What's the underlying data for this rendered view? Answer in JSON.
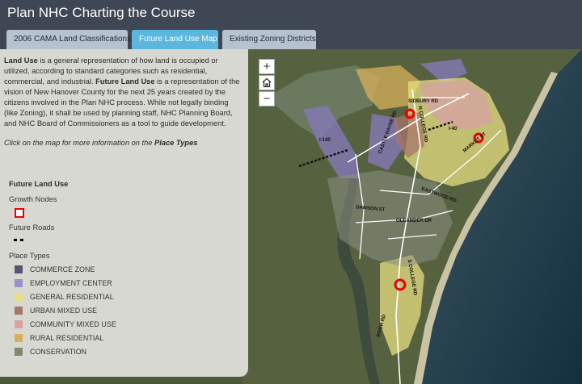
{
  "app": {
    "title": "Plan NHC Charting the Course"
  },
  "tabs": [
    {
      "label": "2006 CAMA Land Classifications",
      "active": false
    },
    {
      "label": "Future Land Use Map",
      "active": true
    },
    {
      "label": "Existing Zoning Districts",
      "active": false
    }
  ],
  "panel": {
    "intro_part1_bold": "Land Use",
    "intro_part1": " is a general representation of how land is occupied or utilized, according to standard categories such as residential, commercial, and industrial. ",
    "intro_part2_bold": "Future Land Use",
    "intro_part2": " is a representation of the vision of New Hanover County for the next 25 years created by the citizens involved in the Plan NHC process. While not legally binding (like Zoning), it shall be used by planning staff, NHC Planning Board, and NHC Board of Commissioners as a tool to guide development.",
    "hint_prefix": "Click on the map for more information on the ",
    "hint_bold": "Place Types",
    "legend_title": "Future Land Use",
    "growth_nodes_label": "Growth Nodes",
    "future_roads_label": "Future Roads",
    "place_types_label": "Place Types",
    "place_types": [
      {
        "label": "COMMERCE ZONE",
        "color": "#5b536f"
      },
      {
        "label": "EMPLOYMENT CENTER",
        "color": "#9a8fc9"
      },
      {
        "label": "GENERAL RESIDENTIAL",
        "color": "#e7df82"
      },
      {
        "label": "URBAN MIXED USE",
        "color": "#a6766a"
      },
      {
        "label": "COMMUNITY MIXED USE",
        "color": "#d6a3a0"
      },
      {
        "label": "RURAL RESIDENTIAL",
        "color": "#d7b05a"
      },
      {
        "label": "CONSERVATION",
        "color": "#7d8a6b"
      }
    ]
  },
  "map": {
    "zoom_in": "+",
    "home_icon": "home-icon",
    "zoom_out": "−",
    "road_labels": [
      {
        "text": "SIDBURY RD",
        "id": "sidbury"
      },
      {
        "text": "MARKET ST",
        "id": "market"
      },
      {
        "text": "CASTLE HAYNE RD",
        "id": "castlehayne"
      },
      {
        "text": "N COLLEGE RD",
        "id": "ncollege"
      },
      {
        "text": "DAWSON ST",
        "id": "dawson"
      },
      {
        "text": "OLEANDER DR",
        "id": "oleander"
      },
      {
        "text": "S COLLEGE RD",
        "id": "scollege"
      },
      {
        "text": "RIVER RD",
        "id": "river"
      },
      {
        "text": "EASTWOOD RD",
        "id": "eastwood"
      },
      {
        "text": "I-140",
        "id": "i140"
      },
      {
        "text": "I-40",
        "id": "i40"
      }
    ]
  }
}
